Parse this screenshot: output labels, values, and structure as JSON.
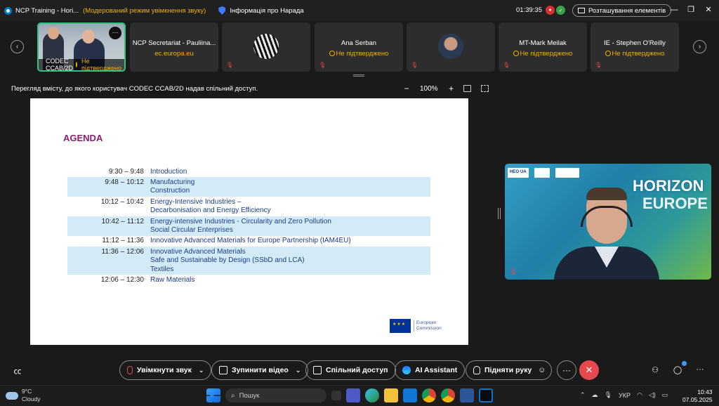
{
  "titlebar": {
    "title": "NCP Training - Hori...",
    "warning": "(Модерований режим увімкнення звуку)",
    "info": "Інформація про Нарада",
    "time": "01:39:35",
    "layout_label": "Розташування елементів"
  },
  "participants": [
    {
      "name": "CODEC CCAB/2D",
      "status": "Не підтверджено"
    },
    {
      "name": "NCP Secretariat - Pauliina...",
      "status": "ec.europa.eu"
    },
    {
      "name": "",
      "status": ""
    },
    {
      "name": "Ana Serban",
      "status": "Не підтверджено"
    },
    {
      "name": "",
      "status": ""
    },
    {
      "name": "MT-Mark Meilak",
      "status": "Не підтверджено"
    },
    {
      "name": "IE - Stephen O'Reilly",
      "status": "Не підтверджено"
    }
  ],
  "sharebar": {
    "text": "Перегляд вмісту, до якого користувач CODEC CCAB/2D надав спільний доступ.",
    "zoom": "100%",
    "zoom_out": "−",
    "zoom_in": "+"
  },
  "slide": {
    "title": "AGENDA",
    "rows": [
      {
        "time": "9:30 –  9:48",
        "topics": [
          "Introduction"
        ],
        "shaded": false
      },
      {
        "time": "9:48 – 10:12",
        "topics": [
          "Manufacturing",
          "Construction"
        ],
        "shaded": true
      },
      {
        "time": "10:12 – 10:42",
        "topics": [
          "Energy-Intensive Industries –",
          "Decarbonisation and Energy Efficiency"
        ],
        "shaded": false
      },
      {
        "time": "10:42 – 11:12",
        "topics": [
          "Energy-intensive Industries - Circularity and Zero Pollution",
          "Social Circular Enterprises"
        ],
        "shaded": true
      },
      {
        "time": "11:12 – 11:36",
        "topics": [
          "Innovative Advanced Materials for Europe Partnership (IAM4EU)"
        ],
        "shaded": false
      },
      {
        "time": "11:36 – 12:06",
        "topics": [
          "Innovative Advanced Materials",
          "Safe and Sustainable by Design (SSbD and LCA)",
          "Textiles"
        ],
        "shaded": true
      },
      {
        "time": "12:06 – 12:30",
        "topics": [
          "Raw Materials"
        ],
        "shaded": false
      }
    ],
    "ec_logo_line1": "European",
    "ec_logo_line2": "Commission"
  },
  "speaker": {
    "logos": [
      "HEO·UA",
      "",
      ""
    ],
    "background_text_1": "HORIZON",
    "background_text_2": "EUROPE"
  },
  "controls": {
    "mute": "Увімкнути звук",
    "video": "Зупинити відео",
    "share": "Спільний доступ",
    "ai": "AI Assistant",
    "hand": "Підняти руку"
  },
  "taskbar": {
    "temp": "9°C",
    "weather": "Cloudy",
    "search_placeholder": "Пошук",
    "lang": "УКР",
    "time": "10:43",
    "date": "07.05.2025"
  },
  "colors": {
    "accent": "#2ec27e",
    "warning": "#f0b000",
    "end_call": "#e5484d",
    "agenda_title": "#8b1e6e",
    "agenda_text": "#1a3c8c",
    "agenda_shade": "#d3ebf6"
  }
}
